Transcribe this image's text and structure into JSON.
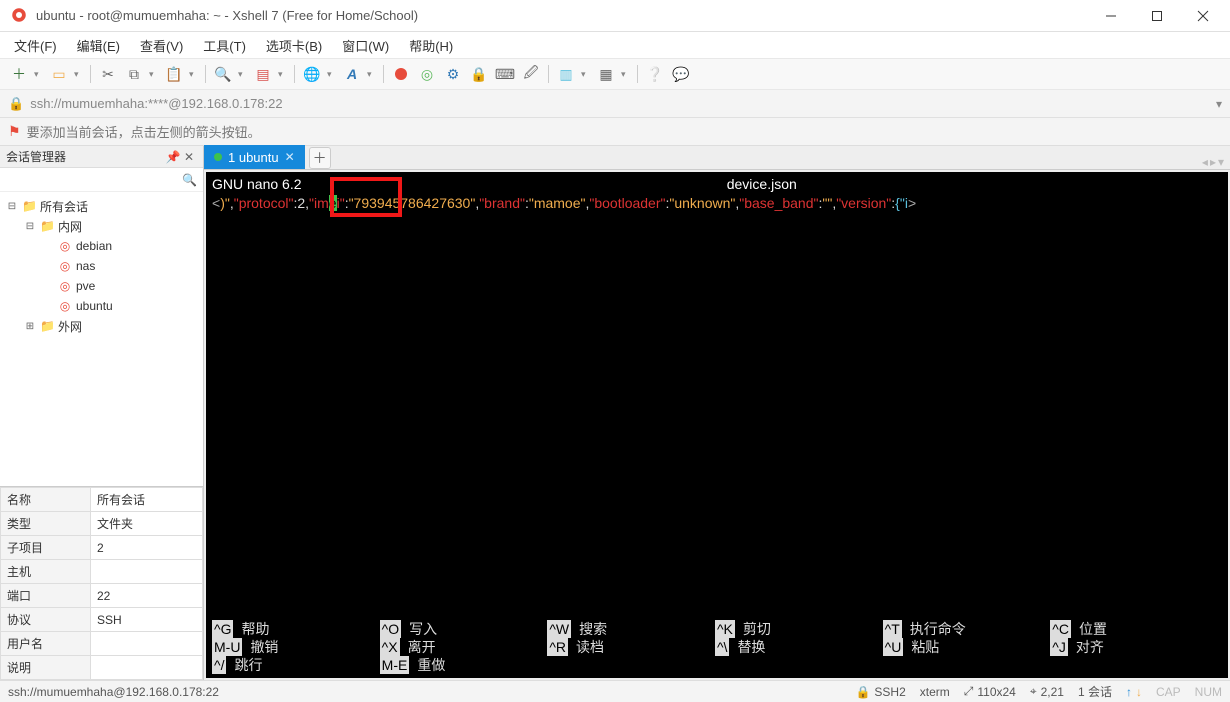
{
  "titlebar": {
    "text": "ubuntu - root@mumuemhaha: ~ - Xshell 7 (Free for Home/School)"
  },
  "menu": [
    "文件(F)",
    "编辑(E)",
    "查看(V)",
    "工具(T)",
    "选项卡(B)",
    "窗口(W)",
    "帮助(H)"
  ],
  "addressbar": {
    "text": "ssh://mumuemhaha:****@192.168.0.178:22"
  },
  "infobar": {
    "text": "要添加当前会话，点击左侧的箭头按钮。"
  },
  "side": {
    "title": "会话管理器",
    "search_placeholder": "",
    "tree": {
      "root": "所有会话",
      "inner": "内网",
      "items": [
        "debian",
        "nas",
        "pve",
        "ubuntu"
      ],
      "outer": "外网"
    },
    "props": [
      {
        "k": "名称",
        "v": "所有会话"
      },
      {
        "k": "类型",
        "v": "文件夹"
      },
      {
        "k": "子项目",
        "v": "2"
      },
      {
        "k": "主机",
        "v": ""
      },
      {
        "k": "端口",
        "v": "22"
      },
      {
        "k": "协议",
        "v": "SSH"
      },
      {
        "k": "用户名",
        "v": ""
      },
      {
        "k": "说明",
        "v": ""
      }
    ]
  },
  "tabs": {
    "active": "1 ubuntu"
  },
  "terminal": {
    "editor": "GNU  nano 6.2",
    "filename": "device.json",
    "line_parts": {
      "pre_lt": "<",
      "close_paren": ")\"",
      "comma1": ",",
      "q_protocol": "\"protocol\"",
      "colon_2_comma": ":2,",
      "q_im": "\"im",
      "e": "e",
      "i_q": "i\"",
      "colon2": ":",
      "imei_v": "\"793945786427630\"",
      "comma2": ",",
      "q_brand": "\"brand\"",
      "colon3": ":",
      "brand_v": "\"mamoe\"",
      "comma3": ",",
      "q_boot": "\"bootloader\"",
      "colon4": ":",
      "boot_v": "\"unknown\"",
      "comma4": ",",
      "q_bb": "\"base_band\"",
      "colon5": ":",
      "bb_v": "\"\"",
      "comma5": ",",
      "q_ver": "\"version\"",
      "colon6": ":",
      "ver_v": "{\"i",
      "post_gt": ">"
    },
    "bottom": [
      {
        "k": "^G",
        "l": "帮助"
      },
      {
        "k": "^O",
        "l": "写入"
      },
      {
        "k": "^W",
        "l": "搜索"
      },
      {
        "k": "^K",
        "l": "剪切"
      },
      {
        "k": "^T",
        "l": "执行命令"
      },
      {
        "k": "^C",
        "l": "位置"
      },
      {
        "k": "M-U",
        "l": "撤销"
      },
      {
        "k": "^X",
        "l": "离开"
      },
      {
        "k": "^R",
        "l": "读档"
      },
      {
        "k": "^\\",
        "l": "替换"
      },
      {
        "k": "^U",
        "l": "粘贴"
      },
      {
        "k": "^J",
        "l": "对齐"
      },
      {
        "k": "^/",
        "l": "跳行"
      },
      {
        "k": "M-E",
        "l": "重做"
      }
    ]
  },
  "status": {
    "left": "ssh://mumuemhaha@192.168.0.178:22",
    "ssh": "SSH2",
    "term": "xterm",
    "size": "110x24",
    "pos": "2,21",
    "sess": "1 会话",
    "cap": "CAP",
    "num": "NUM"
  }
}
